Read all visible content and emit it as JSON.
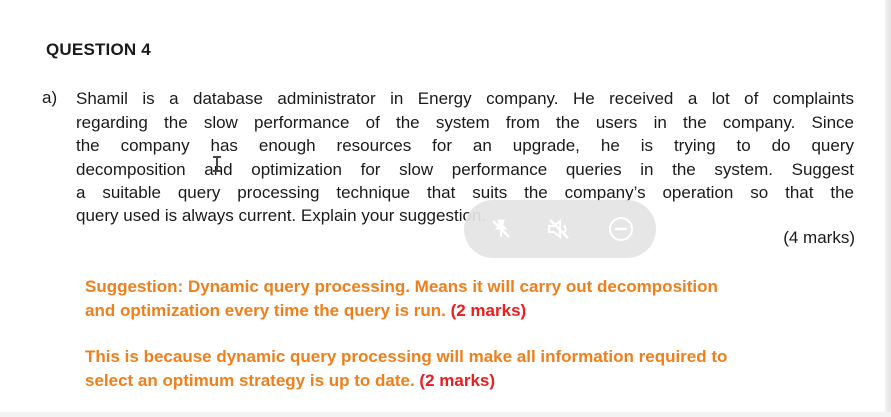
{
  "heading": "QUESTION 4",
  "question": {
    "label": "a)",
    "lines": [
      "Shamil is a database administrator in Energy company. He received a lot of complaints",
      "regarding the slow performance of the system from the users in the company. Since",
      "the company has enough resources for an upgrade, he is trying to do query",
      "decomposition and optimization for slow performance queries in the system. Suggest",
      "a suitable query processing technique that suits the company’s operation so that the",
      "query used is always current. Explain your suggestion."
    ],
    "marks": "(4 marks)"
  },
  "answers": {
    "suggestion": {
      "line1": "Suggestion: Dynamic query processing. Means it will carry out decomposition",
      "line2": "and optimization every time the query is run.",
      "marks": "(2 marks)"
    },
    "reason": {
      "line1": "This is because dynamic query processing will make all information required to",
      "line2": "select an optimum strategy is up to date.",
      "marks": "(2 marks)"
    }
  },
  "overlay_toolbar": {
    "icons": [
      "pin-off-icon",
      "mute-icon",
      "minus-circle-icon"
    ]
  },
  "colors": {
    "answer_text": "#f07f1b",
    "marks_text": "#ee1c1c",
    "overlay_bg": "#e4e4e4"
  }
}
